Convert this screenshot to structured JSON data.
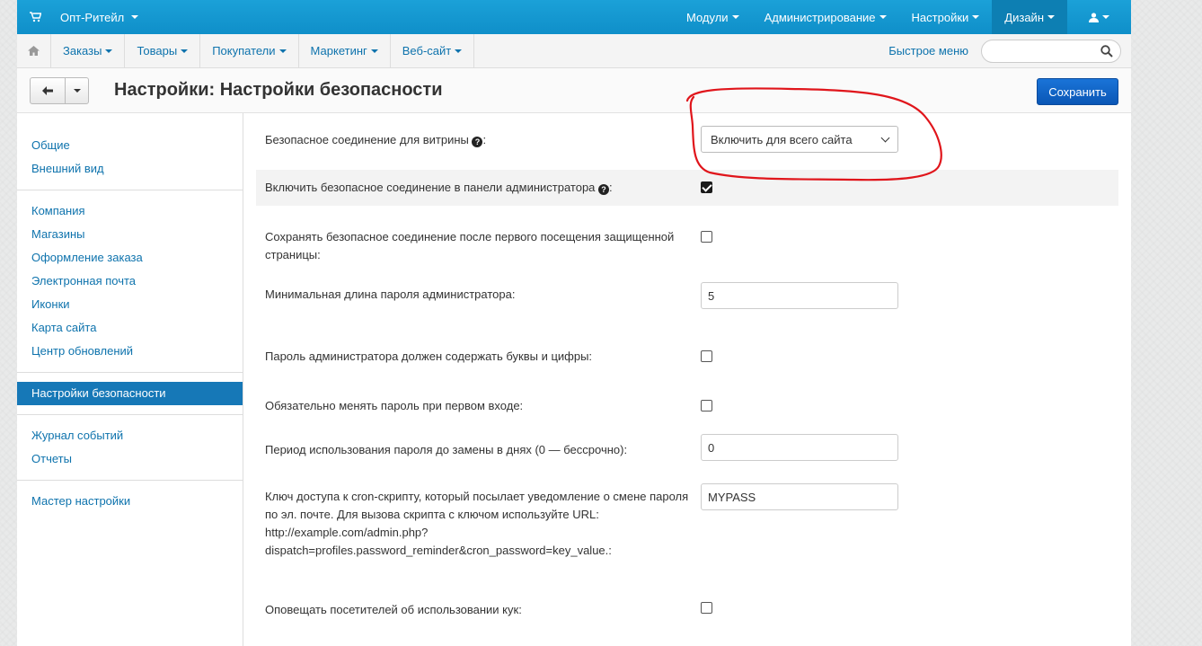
{
  "topbar": {
    "brand": "Опт-Ритейл",
    "nav": [
      {
        "label": "Модули"
      },
      {
        "label": "Администрирование"
      },
      {
        "label": "Настройки"
      },
      {
        "label": "Дизайн"
      }
    ]
  },
  "subnav": {
    "items": [
      {
        "label": "Заказы"
      },
      {
        "label": "Товары"
      },
      {
        "label": "Покупатели"
      },
      {
        "label": "Маркетинг"
      },
      {
        "label": "Веб-сайт"
      }
    ],
    "quick_menu": "Быстрое меню",
    "search_placeholder": ""
  },
  "page": {
    "title": "Настройки: Настройки безопасности",
    "save_label": "Сохранить"
  },
  "sidebar": {
    "groups": [
      [
        {
          "label": "Общие"
        },
        {
          "label": "Внешний вид"
        }
      ],
      [
        {
          "label": "Компания"
        },
        {
          "label": "Магазины"
        },
        {
          "label": "Оформление заказа"
        },
        {
          "label": "Электронная почта"
        },
        {
          "label": "Иконки"
        },
        {
          "label": "Карта сайта"
        },
        {
          "label": "Центр обновлений"
        }
      ],
      [
        {
          "label": "Настройки безопасности",
          "active": true
        }
      ],
      [
        {
          "label": "Журнал событий"
        },
        {
          "label": "Отчеты"
        }
      ],
      [
        {
          "label": "Мастер настройки"
        }
      ]
    ]
  },
  "settings": {
    "secure_storefront": {
      "label": "Безопасное соединение для витрины",
      "value": "Включить для всего сайта"
    },
    "secure_admin": {
      "label": "Включить безопасное соединение в панели администратора",
      "checked": true
    },
    "keep_secure": {
      "label": "Сохранять безопасное соединение после первого посещения защищенной страницы:",
      "checked": false
    },
    "min_password_length": {
      "label": "Минимальная длина пароля администратора:",
      "value": "5"
    },
    "password_letters_digits": {
      "label": "Пароль администратора должен содержать буквы и цифры:",
      "checked": false
    },
    "change_password_first_login": {
      "label": "Обязательно менять пароль при первом входе:",
      "checked": false
    },
    "password_period": {
      "label": "Период использования пароля до замены в днях (0 — бессрочно):",
      "value": "0"
    },
    "cron_key": {
      "label_lines": [
        "Ключ доступа к cron-скрипту, который посылает уведомление о смене пароля",
        "по эл. почте. Для вызова скрипта с ключом используйте URL:",
        "http://example.com/admin.php?",
        "dispatch=profiles.password_reminder&cron_password=key_value.:"
      ],
      "value": "MYPASS"
    },
    "cookie_notice": {
      "label": "Оповещать посетителей об использовании кук:",
      "checked": false
    }
  },
  "colors": {
    "topbar": "#1ba1d8",
    "link": "#0e73ad",
    "active_sidebar": "#1678b7",
    "save_button": "#0a56b5",
    "annotation": "#e0151b"
  }
}
